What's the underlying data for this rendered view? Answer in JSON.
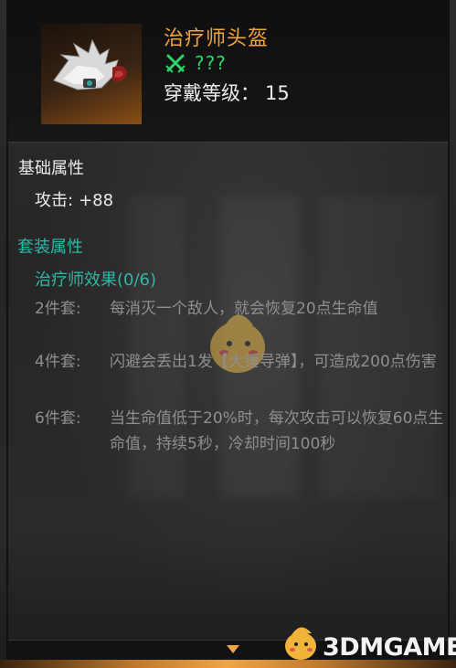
{
  "item": {
    "name": "治疗师头盔",
    "set_unknown": "???",
    "level_label": "穿戴等级：",
    "level_value": "15"
  },
  "base_attributes": {
    "heading": "基础属性",
    "stats": [
      {
        "label": "攻击:",
        "value": "+88"
      }
    ]
  },
  "set_attributes": {
    "heading": "套装属性",
    "set_name": "治疗师效果(0/6)",
    "bonuses": [
      {
        "label": "2件套:",
        "text": "每消灭一个敌人，就会恢复20点生命值"
      },
      {
        "label": "4件套:",
        "text": "闪避会丢出1发【大锤导弹】，可造成200点伤害"
      },
      {
        "label": "6件套:",
        "text": "当生命值低于20%时，每次攻击可以恢复60点生命值，持续5秒，冷却时间100秒"
      }
    ]
  },
  "watermark": {
    "text": "3DMGAME"
  },
  "colors": {
    "title": "#f0a33a",
    "set_green": "#2ed36a",
    "set_teal": "#2db8a4",
    "inactive_text": "#8f8f8f",
    "text": "#ececec",
    "accent_orange": "#f0a446"
  },
  "icons": {
    "item": "helmet-icon",
    "set": "crossed-swords-icon",
    "scroll": "chevron-down-icon",
    "watermark": "3dm-mascot-logo"
  }
}
